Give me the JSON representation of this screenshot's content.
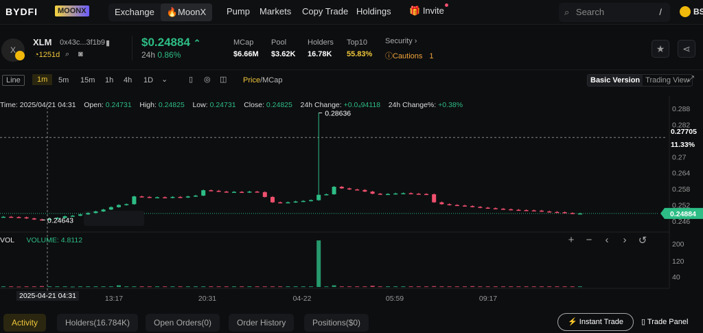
{
  "nav": {
    "brand": "BYDFI",
    "brand_badge": "MOONX",
    "items": [
      "Exchange",
      "🔥MoonX"
    ],
    "links": [
      "Pump",
      "Markets",
      "Copy Trade",
      "Holdings"
    ],
    "invite": "Invite",
    "search_placeholder": "Search",
    "search_shortcut": "/",
    "chain": "BS"
  },
  "token": {
    "symbol": "XLM",
    "avatar_letter": "X",
    "address": "0x43c...3f1b9",
    "age": "1251d",
    "price": "$0.24884",
    "change_label": "24h",
    "change": "0.86%",
    "stats": [
      {
        "label": "MCap",
        "value": "$6.66M"
      },
      {
        "label": "Pool",
        "value": "$3.62K"
      },
      {
        "label": "Holders",
        "value": "16.78K"
      },
      {
        "label": "Top10",
        "value": "55.83%"
      }
    ],
    "security_label": "Security",
    "security_value": "Cautions",
    "security_count": "1"
  },
  "toolbar": {
    "line": "Line",
    "intervals": [
      "1m",
      "5m",
      "15m",
      "1h",
      "4h",
      "1D"
    ],
    "active_interval": "1m",
    "price_label": "Price",
    "mcap_label": "/MCap",
    "basic": "Basic Version",
    "trading": "Trading View"
  },
  "ohlc": {
    "time_label": "Time:",
    "time": "2025/04/21 04:31",
    "open_label": "Open:",
    "open": "0.24731",
    "high_label": "High:",
    "high": "0.24825",
    "low_label": "Low:",
    "low": "0.24731",
    "close_label": "Close:",
    "close": "0.24825",
    "chg_label": "24h Change:",
    "chg": "+0.0₄94118",
    "chgp_label": "24h Change%:",
    "chgp": "+0.38%"
  },
  "chart_data": {
    "type": "candlestick",
    "price_ticks": [
      "0.288",
      "0.282",
      "0.27",
      "0.264",
      "0.258",
      "0.252",
      "0.246"
    ],
    "ylim": [
      0.246,
      0.288
    ],
    "high_marker": "0.28636",
    "low_marker": "0.24643",
    "crosshair_price": "0.27705",
    "crosshair_pct": "11.33%",
    "last_price": "0.24884",
    "spike_index": 41,
    "spike_high": 0.28636,
    "closes": [
      0.2476,
      0.2475,
      0.2474,
      0.247,
      0.2466,
      0.24643,
      0.2468,
      0.2472,
      0.2478,
      0.248,
      0.2485,
      0.249,
      0.2496,
      0.2503,
      0.2512,
      0.252,
      0.2523,
      0.2552,
      0.255,
      0.2548,
      0.2549,
      0.2547,
      0.255,
      0.2548,
      0.2552,
      0.2555,
      0.2575,
      0.2573,
      0.257,
      0.2568,
      0.2569,
      0.2567,
      0.257,
      0.2568,
      0.255,
      0.253,
      0.2528,
      0.253,
      0.2533,
      0.2535,
      0.2538,
      0.2558,
      0.256,
      0.2588,
      0.2582,
      0.2578,
      0.2576,
      0.257,
      0.2562,
      0.256,
      0.2561,
      0.2563,
      0.2564,
      0.2562,
      0.2561,
      0.256,
      0.253,
      0.2523,
      0.252,
      0.2518,
      0.2516,
      0.2513,
      0.251,
      0.2508,
      0.2506,
      0.2504,
      0.2502,
      0.2501,
      0.25,
      0.2499,
      0.2496,
      0.2494,
      0.2493,
      0.249,
      0.24884,
      0.24884
    ],
    "volume_label": "VOL",
    "volume_text": "VOLUME: 4.8112",
    "volumes": [
      3,
      3,
      2,
      3,
      3,
      4,
      3,
      3,
      3,
      2,
      3,
      3,
      3,
      3,
      3,
      8,
      3,
      3,
      3,
      3,
      3,
      3,
      3,
      3,
      3,
      3,
      3,
      3,
      3,
      3,
      3,
      3,
      3,
      3,
      3,
      3,
      3,
      3,
      3,
      3,
      3,
      220,
      3,
      8,
      3,
      3,
      3,
      3,
      6,
      3,
      3,
      3,
      3,
      3,
      3,
      3,
      4,
      3,
      3,
      3,
      3,
      4,
      3,
      3,
      3,
      3,
      3,
      3,
      3,
      3,
      3,
      3,
      3,
      3,
      3,
      3
    ],
    "volume_ticks": [
      "200",
      "120",
      "40"
    ],
    "vlim": [
      0,
      240
    ],
    "time_ticks": [
      "13:17",
      "20:31",
      "04-22",
      "05:59",
      "09:17"
    ],
    "crosshair_time": "2025-04-21 04:31"
  },
  "tabs": [
    "Activity",
    "Holders(16.784K)",
    "Open Orders(0)",
    "Order History",
    "Positions($0)"
  ],
  "instant_trade": "Instant Trade",
  "trade_panel": "Trade Panel",
  "colors": {
    "up": "#2dbd85",
    "down": "#f0506e",
    "accent": "#f0c73a"
  }
}
